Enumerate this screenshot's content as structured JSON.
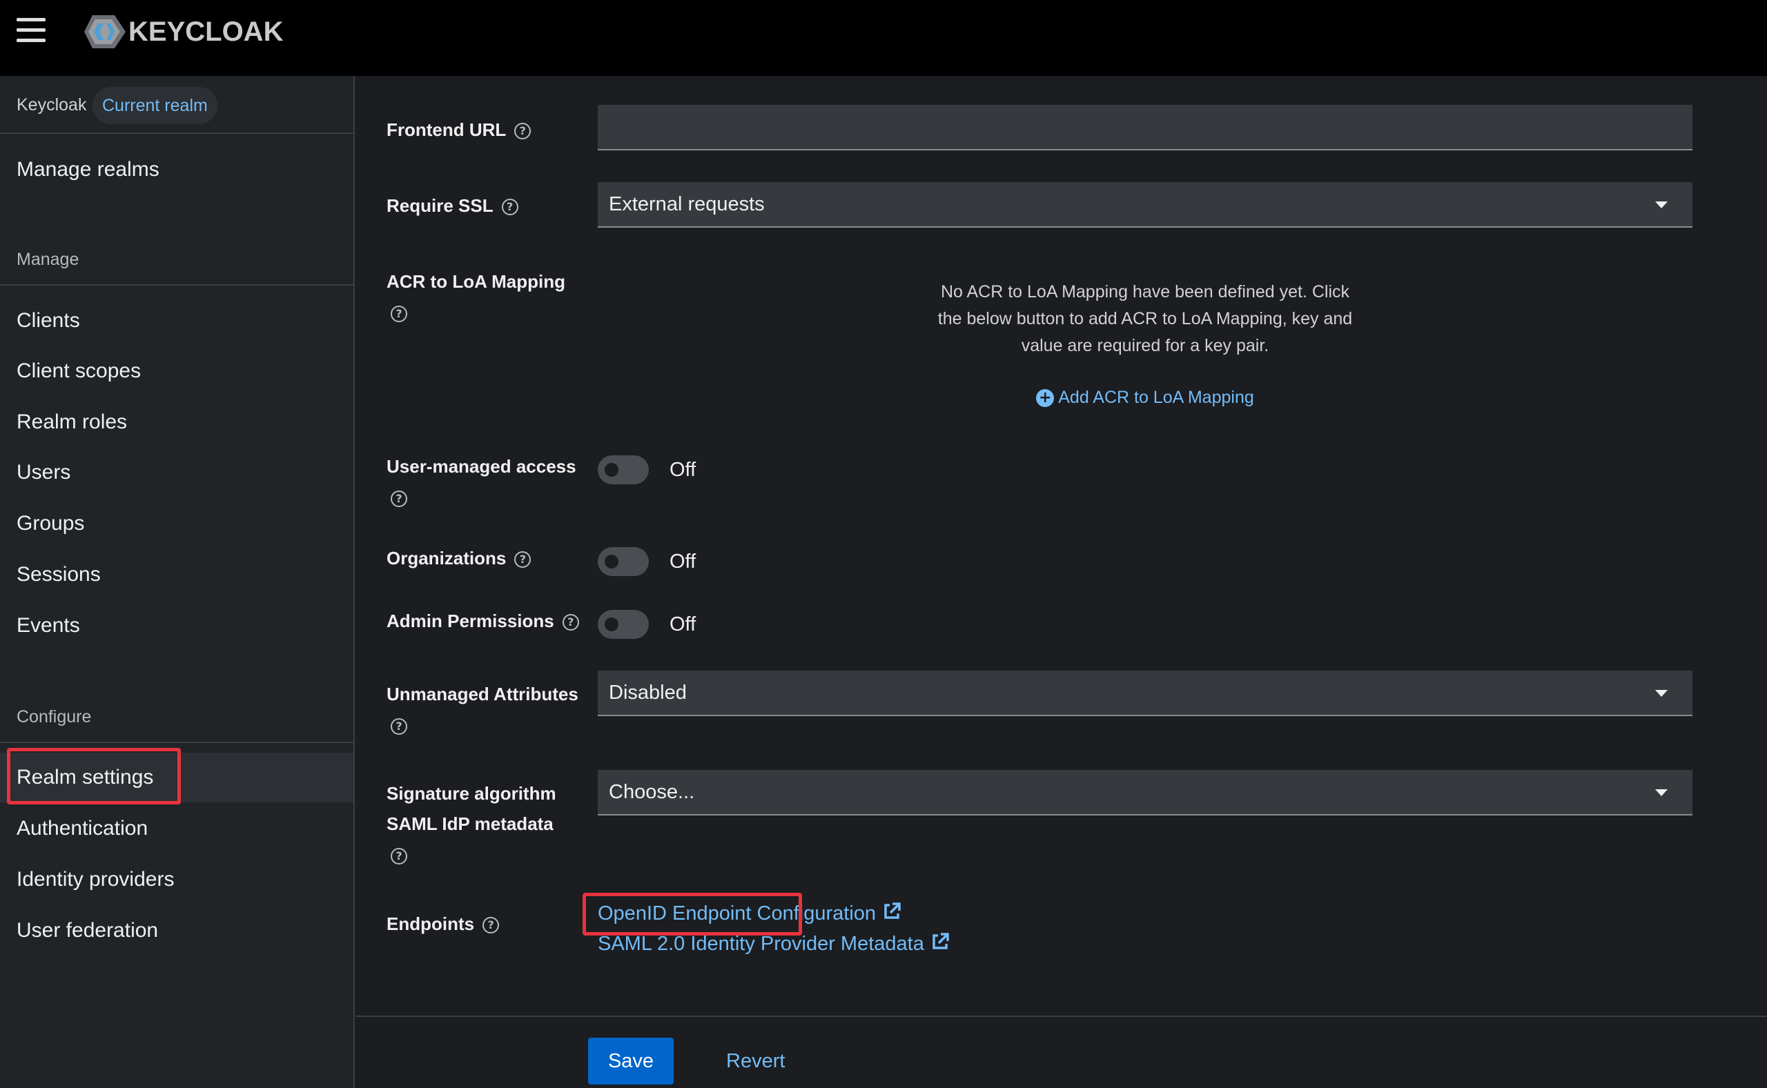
{
  "header": {
    "logo_text": "KEYCLOAK",
    "menu_icon": "hamburger-menu-icon"
  },
  "sidebar": {
    "realm_name": "Keycloak",
    "realm_badge": "Current realm",
    "manage_realms": "Manage realms",
    "manage_section": "Manage",
    "manage_items": [
      "Clients",
      "Client scopes",
      "Realm roles",
      "Users",
      "Groups",
      "Sessions",
      "Events"
    ],
    "configure_section": "Configure",
    "configure_items": [
      "Realm settings",
      "Authentication",
      "Identity providers",
      "User federation"
    ],
    "active_item": "Realm settings"
  },
  "form": {
    "frontend_url": {
      "label": "Frontend URL",
      "value": ""
    },
    "require_ssl": {
      "label": "Require SSL",
      "value": "External requests"
    },
    "acr_mapping": {
      "label": "ACR to LoA Mapping",
      "empty_line1": "No ACR to LoA Mapping have been defined yet. Click",
      "empty_line2": "the below button to add ACR to LoA Mapping, key and",
      "empty_line3": "value are required for a key pair.",
      "add_label": "Add ACR to LoA Mapping"
    },
    "user_managed_access": {
      "label": "User-managed access",
      "state": "Off"
    },
    "organizations": {
      "label": "Organizations",
      "state": "Off"
    },
    "admin_permissions": {
      "label": "Admin Permissions",
      "state": "Off"
    },
    "unmanaged_attributes": {
      "label": "Unmanaged Attributes",
      "value": "Disabled"
    },
    "signature_algorithm": {
      "label_line1": "Signature algorithm",
      "label_line2": "SAML IdP metadata",
      "value": "Choose..."
    },
    "endpoints": {
      "label": "Endpoints",
      "openid": "OpenID Endpoint Configuration",
      "saml": "SAML 2.0 Identity Provider Metadata"
    }
  },
  "actions": {
    "save": "Save",
    "revert": "Revert"
  },
  "colors": {
    "accent": "#0066cc",
    "link": "#73bcf7",
    "highlight": "#e8333d"
  }
}
